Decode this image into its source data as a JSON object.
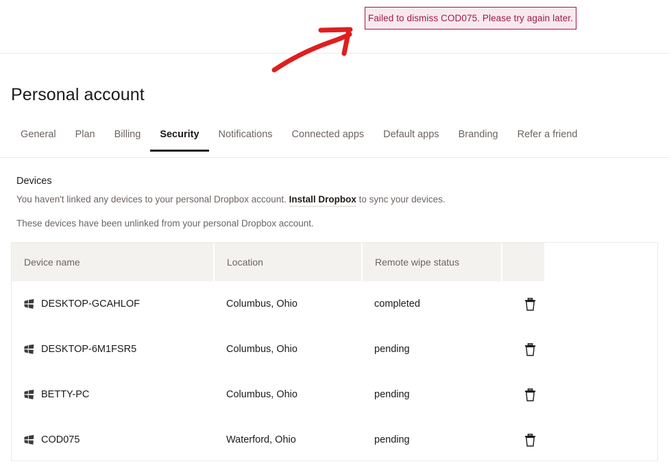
{
  "alert": {
    "message": "Failed to dismiss COD075. Please try again later.",
    "border_color": "#a5153f",
    "background_color": "#f8e9ee",
    "text_color": "#9c1b45"
  },
  "annotation": {
    "type": "arrow",
    "color": "#e01e1e",
    "direction": "up-right",
    "points_to": "alert-banner"
  },
  "page": {
    "title": "Personal account"
  },
  "tabs": [
    {
      "label": "General",
      "active": false
    },
    {
      "label": "Plan",
      "active": false
    },
    {
      "label": "Billing",
      "active": false
    },
    {
      "label": "Security",
      "active": true
    },
    {
      "label": "Notifications",
      "active": false
    },
    {
      "label": "Connected apps",
      "active": false
    },
    {
      "label": "Default apps",
      "active": false
    },
    {
      "label": "Branding",
      "active": false
    },
    {
      "label": "Refer a friend",
      "active": false
    }
  ],
  "devices_section": {
    "heading": "Devices",
    "description_before_link": "You haven't linked any devices to your personal Dropbox account. ",
    "link_label": "Install Dropbox",
    "description_after_link": " to sync your devices.",
    "subdescription": "These devices have been unlinked from your personal Dropbox account."
  },
  "table": {
    "columns": [
      "Device name",
      "Location",
      "Remote wipe status",
      ""
    ],
    "rows": [
      {
        "icon": "windows-icon",
        "device_name": "DESKTOP-GCAHLOF",
        "location": "Columbus, Ohio",
        "remote_wipe_status": "completed",
        "action_icon": "trash-icon"
      },
      {
        "icon": "windows-icon",
        "device_name": "DESKTOP-6M1FSR5",
        "location": "Columbus, Ohio",
        "remote_wipe_status": "pending",
        "action_icon": "trash-icon"
      },
      {
        "icon": "windows-icon",
        "device_name": "BETTY-PC",
        "location": "Columbus, Ohio",
        "remote_wipe_status": "pending",
        "action_icon": "trash-icon"
      },
      {
        "icon": "windows-icon",
        "device_name": "COD075",
        "location": "Waterford, Ohio",
        "remote_wipe_status": "pending",
        "action_icon": "trash-icon"
      }
    ]
  }
}
